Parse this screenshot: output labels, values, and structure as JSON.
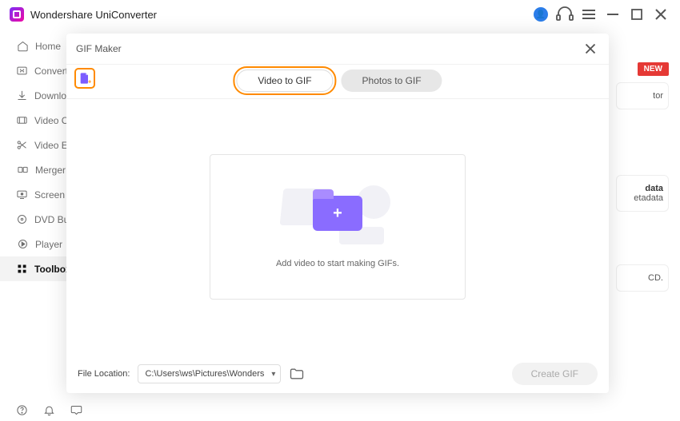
{
  "app": {
    "title": "Wondershare UniConverter"
  },
  "titlebar": {
    "user_icon": "user-icon",
    "help_icon": "headset-icon",
    "menu_icon": "menu-icon",
    "min_icon": "minimize-icon",
    "max_icon": "maximize-icon",
    "close_icon": "close-icon"
  },
  "sidebar": {
    "items": [
      {
        "label": "Home",
        "icon": "home-icon"
      },
      {
        "label": "Converter",
        "icon": "converter-icon"
      },
      {
        "label": "Downloader",
        "icon": "download-icon"
      },
      {
        "label": "Video Compressor",
        "icon": "compress-icon"
      },
      {
        "label": "Video Editor",
        "icon": "scissors-icon"
      },
      {
        "label": "Merger",
        "icon": "merge-icon"
      },
      {
        "label": "Screen Recorder",
        "icon": "record-icon"
      },
      {
        "label": "DVD Burner",
        "icon": "disc-icon"
      },
      {
        "label": "Player",
        "icon": "play-icon"
      },
      {
        "label": "Toolbox",
        "icon": "grid-icon",
        "active": true
      }
    ]
  },
  "right": {
    "new_badge": "NEW",
    "frag1a": "tor",
    "frag2a": "data",
    "frag2b": "etadata",
    "frag3a": "CD."
  },
  "panel": {
    "title": "GIF Maker",
    "tabs": {
      "video": "Video to GIF",
      "photos": "Photos to GIF"
    },
    "drop_text": "Add video to start making GIFs.",
    "file_location_label": "File Location:",
    "file_location_value": "C:\\Users\\ws\\Pictures\\Wonders",
    "create_button": "Create GIF"
  }
}
